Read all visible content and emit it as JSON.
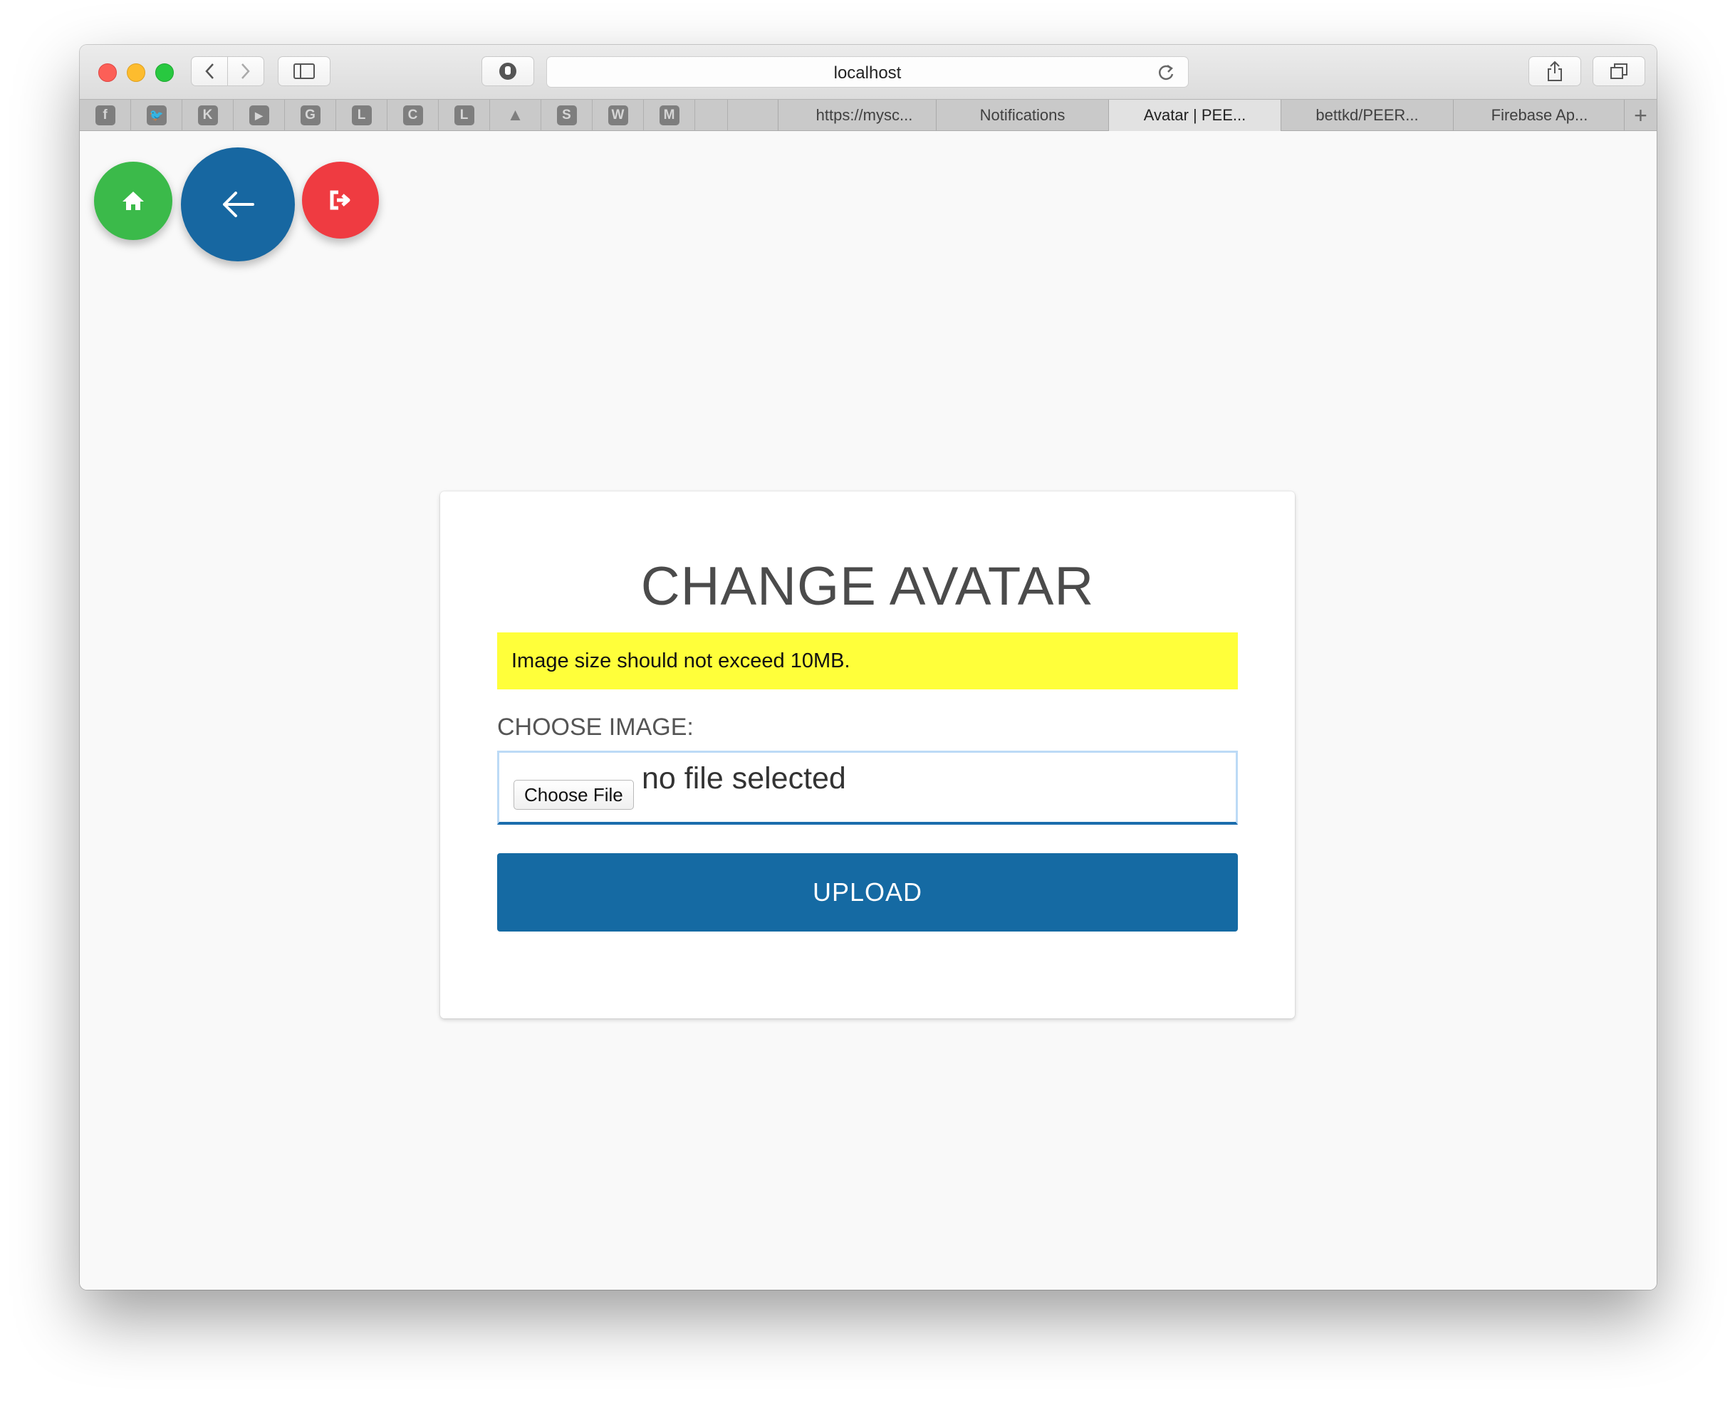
{
  "browser": {
    "url": "localhost",
    "favorites": [
      {
        "icon": "facebook-icon",
        "glyph": "f"
      },
      {
        "icon": "twitter-icon",
        "glyph": "🐦"
      },
      {
        "icon": "k-bookmark-icon",
        "glyph": "K"
      },
      {
        "icon": "youtube-icon",
        "glyph": "▶"
      },
      {
        "icon": "g-bookmark-icon",
        "glyph": "G"
      },
      {
        "icon": "l-bookmark-icon",
        "glyph": "L"
      },
      {
        "icon": "c-bookmark-icon",
        "glyph": "C"
      },
      {
        "icon": "l-bookmark-icon-2",
        "glyph": "L"
      },
      {
        "icon": "google-drive-icon",
        "glyph": "▲"
      },
      {
        "icon": "s-bookmark-icon",
        "glyph": "S"
      },
      {
        "icon": "w-bookmark-icon",
        "glyph": "W"
      },
      {
        "icon": "m-bookmark-icon",
        "glyph": "M"
      }
    ],
    "tabs": [
      {
        "label": "https://mysc...",
        "active": false
      },
      {
        "label": "Notifications",
        "active": false
      },
      {
        "label": "Avatar | PEE...",
        "active": true
      },
      {
        "label": "bettkd/PEER...",
        "active": false
      },
      {
        "label": "Firebase Ap...",
        "active": false
      }
    ],
    "new_tab_glyph": "+"
  },
  "page": {
    "nav": {
      "home_color": "#3bba4a",
      "back_color": "#1767a1",
      "logout_color": "#ef3b41"
    },
    "card": {
      "title": "CHANGE AVATAR",
      "notice": "Image size should not exceed 10MB.",
      "notice_color": "#ffff3a",
      "field_label": "CHOOSE IMAGE:",
      "choose_file_label": "Choose File",
      "file_status": "no file selected",
      "upload_label": "UPLOAD",
      "upload_color": "#156aa3"
    }
  }
}
